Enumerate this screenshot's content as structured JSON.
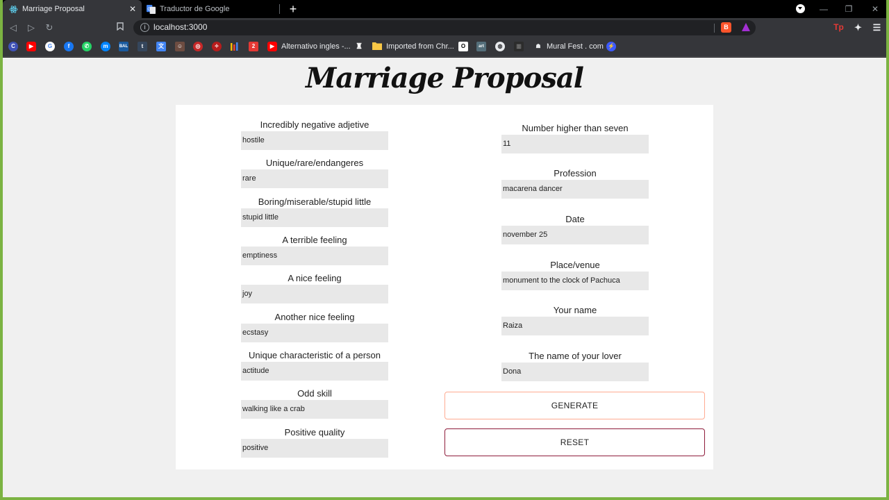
{
  "browser": {
    "tabs": [
      {
        "title": "Marriage Proposal",
        "icon": "react-icon"
      },
      {
        "title": "Traductor de Google",
        "icon": "google-translate-icon"
      }
    ],
    "url": "localhost:3000",
    "bookmarks": [
      {
        "label": "Alternativo ingles -...",
        "icon": "youtube-icon"
      },
      {
        "label": "Imported from Chr...",
        "icon": "folder-icon"
      },
      {
        "label": "Mural Fest . com",
        "icon": "mural-icon"
      }
    ]
  },
  "page": {
    "title": "Marriage Proposal",
    "left_fields": [
      {
        "label": "Incredibly negative adjetive",
        "value": "hostile"
      },
      {
        "label": "Unique/rare/endangeres",
        "value": "rare"
      },
      {
        "label": "Boring/miserable/stupid little",
        "value": "stupid little"
      },
      {
        "label": "A terrible feeling",
        "value": "emptiness"
      },
      {
        "label": "A nice feeling",
        "value": "joy"
      },
      {
        "label": "Another nice feeling",
        "value": "ecstasy"
      },
      {
        "label": "Unique characteristic of a person",
        "value": "actitude"
      },
      {
        "label": "Odd skill",
        "value": "walking like a crab"
      },
      {
        "label": "Positive quality",
        "value": "positive"
      }
    ],
    "right_fields": [
      {
        "label": "Number higher than seven",
        "value": "11"
      },
      {
        "label": "Profession",
        "value": "macarena dancer"
      },
      {
        "label": "Date",
        "value": "november 25"
      },
      {
        "label": "Place/venue",
        "value": "monument to the clock of Pachuca"
      },
      {
        "label": "Your name",
        "value": "Raiza"
      },
      {
        "label": "The name of your lover",
        "value": "Dona"
      }
    ],
    "generate_label": "GENERATE",
    "reset_label": "RESET",
    "colors": {
      "generate_border": "#ffab91",
      "reset_border": "#8e1b3a",
      "frame": "#7cb342"
    }
  }
}
